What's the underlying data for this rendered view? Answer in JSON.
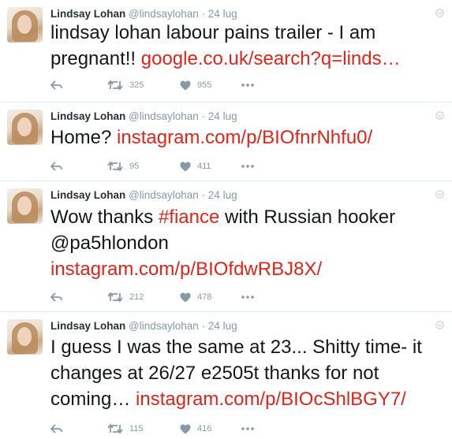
{
  "tweets": [
    {
      "name": "Lindsay Lohan",
      "handle": "@lindsaylohan",
      "date": "24 lug",
      "text_parts": [
        "lindsay lohan labour pains trailer - I am pregnant!! ",
        "google.co.uk/search?q=linds…"
      ],
      "retweets": "325",
      "likes": "955"
    },
    {
      "name": "Lindsay Lohan",
      "handle": "@lindsaylohan",
      "date": "24 lug",
      "text_parts": [
        "Home? ",
        "instagram.com/p/BIOfnrNhfu0/"
      ],
      "retweets": "95",
      "likes": "411"
    },
    {
      "name": "Lindsay Lohan",
      "handle": "@lindsaylohan",
      "date": "24 lug",
      "text_parts": [
        "Wow thanks ",
        "#fiance",
        " with Russian hooker @pa5hlondon",
        "instagram.com/p/BIOfdwRBJ8X/"
      ],
      "retweets": "212",
      "likes": "478"
    },
    {
      "name": "Lindsay Lohan",
      "handle": "@lindsaylohan",
      "date": "24 lug",
      "text_parts": [
        "I guess I was the same at 23... Shitty time- it changes at 26/27  e2505t thanks for not coming… ",
        "instagram.com/p/BIOcShlBGY7/"
      ],
      "retweets": "115",
      "likes": "416"
    }
  ],
  "colors": {
    "link": "#e0241a",
    "meta": "#8899a6",
    "divider": "#e1e8ed"
  },
  "icons": [
    "reply-icon",
    "retweet-icon",
    "heart-icon",
    "more-icon",
    "caret-down-icon"
  ]
}
